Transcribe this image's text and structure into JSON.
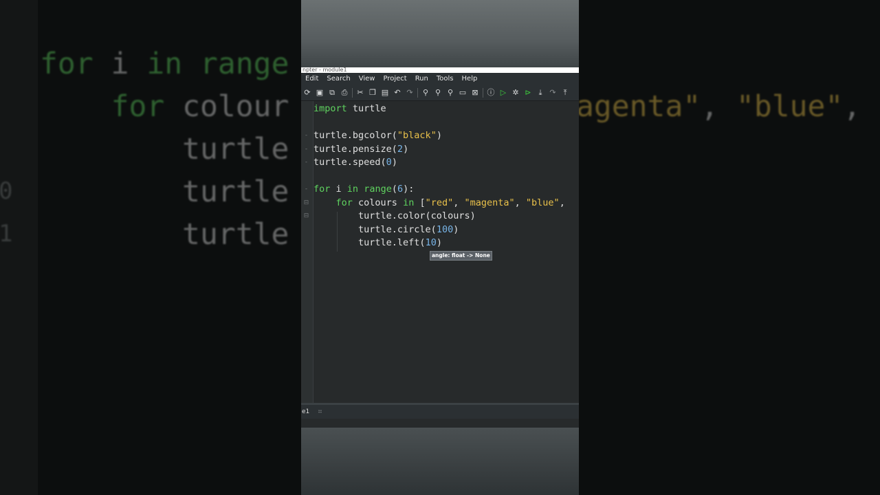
{
  "window": {
    "title": "npter - module1"
  },
  "menu": [
    "Edit",
    "Search",
    "View",
    "Project",
    "Run",
    "Tools",
    "Help"
  ],
  "toolbar": [
    {
      "icon": "open-file-icon",
      "glyph": "⟳"
    },
    {
      "icon": "save-icon",
      "glyph": "▣"
    },
    {
      "icon": "save-all-icon",
      "glyph": "⧉"
    },
    {
      "icon": "print-icon",
      "glyph": "⎙"
    },
    {
      "icon": "cut-icon",
      "glyph": "✂"
    },
    {
      "icon": "copy-icon",
      "glyph": "❐"
    },
    {
      "icon": "paste-icon",
      "glyph": "▤"
    },
    {
      "icon": "undo-icon",
      "glyph": "↶"
    },
    {
      "icon": "redo-icon",
      "glyph": "↷"
    },
    {
      "icon": "find-icon",
      "glyph": "⚲"
    },
    {
      "icon": "find-next-icon",
      "glyph": "⚲"
    },
    {
      "icon": "replace-icon",
      "glyph": "⚲"
    },
    {
      "icon": "folder-icon",
      "glyph": "▭"
    },
    {
      "icon": "browser-icon",
      "glyph": "⊠"
    },
    {
      "icon": "info-icon",
      "glyph": "ⓘ"
    },
    {
      "icon": "run-icon",
      "glyph": "▷"
    },
    {
      "icon": "debug-icon",
      "glyph": "✲"
    },
    {
      "icon": "run-to-cursor-icon",
      "glyph": "⊳"
    },
    {
      "icon": "step-into-icon",
      "glyph": "⤓"
    },
    {
      "icon": "step-over-icon",
      "glyph": "↷"
    },
    {
      "icon": "step-out-icon",
      "glyph": "⤒"
    }
  ],
  "editor": {
    "lines": [
      [
        {
          "t": "kw",
          "v": "import"
        },
        {
          "t": "tx",
          "v": " turtle"
        }
      ],
      [],
      [
        {
          "t": "tx",
          "v": "turtle.bgcolor("
        },
        {
          "t": "str",
          "v": "\"black\""
        },
        {
          "t": "tx",
          "v": ")"
        }
      ],
      [
        {
          "t": "tx",
          "v": "turtle.pensize("
        },
        {
          "t": "num",
          "v": "2"
        },
        {
          "t": "tx",
          "v": ")"
        }
      ],
      [
        {
          "t": "tx",
          "v": "turtle.speed("
        },
        {
          "t": "num",
          "v": "0"
        },
        {
          "t": "tx",
          "v": ")"
        }
      ],
      [],
      [
        {
          "t": "kw",
          "v": "for"
        },
        {
          "t": "tx",
          "v": " i "
        },
        {
          "t": "kw",
          "v": "in"
        },
        {
          "t": "tx",
          "v": " "
        },
        {
          "t": "kw",
          "v": "range"
        },
        {
          "t": "tx",
          "v": "("
        },
        {
          "t": "num",
          "v": "6"
        },
        {
          "t": "tx",
          "v": "):"
        }
      ],
      [
        {
          "t": "tx",
          "v": "    "
        },
        {
          "t": "kw",
          "v": "for"
        },
        {
          "t": "tx",
          "v": " colours "
        },
        {
          "t": "kw",
          "v": "in"
        },
        {
          "t": "tx",
          "v": " ["
        },
        {
          "t": "str",
          "v": "\"red\""
        },
        {
          "t": "tx",
          "v": ", "
        },
        {
          "t": "str",
          "v": "\"magenta\""
        },
        {
          "t": "tx",
          "v": ", "
        },
        {
          "t": "str",
          "v": "\"blue\""
        },
        {
          "t": "tx",
          "v": ","
        }
      ],
      [
        {
          "t": "tx",
          "v": "        turtle.color(colours)"
        }
      ],
      [
        {
          "t": "tx",
          "v": "        turtle.circle("
        },
        {
          "t": "num",
          "v": "100"
        },
        {
          "t": "tx",
          "v": ")"
        }
      ],
      [
        {
          "t": "tx",
          "v": "        turtle.left("
        },
        {
          "t": "num",
          "v": "10"
        },
        {
          "t": "tx",
          "v": ")"
        }
      ]
    ],
    "tooltip": "angle: float -> None"
  },
  "shell": {
    "tab": "e1",
    "close": "⠶"
  },
  "background": {
    "left_lines": [
      {
        "parts": [
          {
            "t": "kw",
            "v": "for"
          },
          {
            "t": "tx",
            "v": " i "
          },
          {
            "t": "kw",
            "v": "in"
          },
          {
            "t": "tx",
            "v": " "
          },
          {
            "t": "kw",
            "v": "range"
          }
        ]
      },
      {
        "parts": [
          {
            "t": "tx",
            "v": "    "
          },
          {
            "t": "kw",
            "v": "for"
          },
          {
            "t": "tx",
            "v": " colour"
          }
        ]
      },
      {
        "parts": [
          {
            "t": "tx",
            "v": "        turtle"
          }
        ]
      },
      {
        "parts": [
          {
            "t": "tx",
            "v": "        turtle"
          }
        ]
      },
      {
        "parts": [
          {
            "t": "tx",
            "v": "        turtle"
          }
        ]
      }
    ],
    "right_line": [
      {
        "t": "str",
        "v": "agenta\""
      },
      {
        "t": "tx",
        "v": ", "
      },
      {
        "t": "str",
        "v": "\"blue\""
      },
      {
        "t": "tx",
        "v": ","
      }
    ],
    "gutter_numbers": [
      "0",
      "1"
    ]
  }
}
